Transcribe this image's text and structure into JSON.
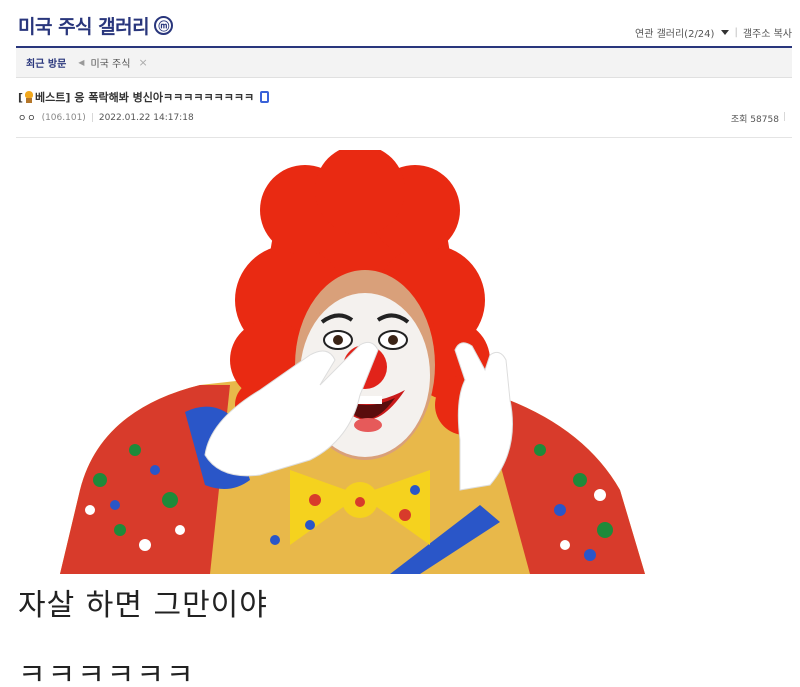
{
  "gallery": {
    "title": "미국 주식 갤러리",
    "badge": "ⓜ",
    "related_label": "연관 갤러리(2/24)",
    "copy_label": "갤주소 복사"
  },
  "recent": {
    "title": "최근 방문",
    "items": [
      "미국 주식"
    ],
    "close": "×"
  },
  "post": {
    "title_prefix": "[",
    "title_tag": "베스트]",
    "title_text": "응 폭락해봐 병신아ㅋㅋㅋㅋㅋㅋㅋㅋㅋ",
    "author": "ㅇㅇ",
    "ip": "(106.101)",
    "date": "2022.01.22 14:17:18",
    "views_label": "조회 58758",
    "views_sep": "|",
    "body": [
      "자살 하면 그만이야",
      "ㅋㅋㅋㅋㅋㅋ"
    ]
  },
  "icons": {
    "best": "trophy-icon",
    "mobile": "mobile-icon",
    "badge": "minor-gallery-icon",
    "dropdown": "caret-down-icon",
    "prev": "chevron-left-icon"
  },
  "colors": {
    "brand": "#29367c",
    "mobile": "#3a62d8",
    "best": "#f2a81d"
  }
}
